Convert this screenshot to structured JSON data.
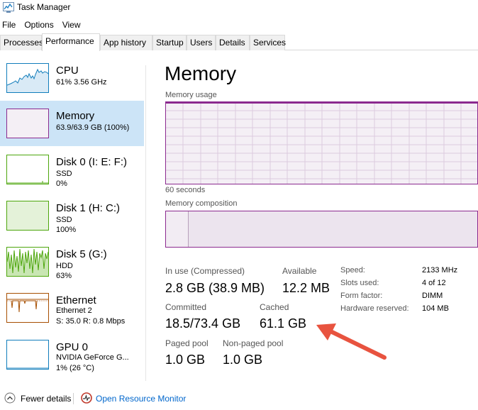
{
  "window": {
    "title": "Task Manager"
  },
  "menu": [
    "File",
    "Options",
    "View"
  ],
  "tabs": [
    "Processes",
    "Performance",
    "App history",
    "Startup",
    "Users",
    "Details",
    "Services"
  ],
  "sidebar": [
    {
      "title": "CPU",
      "line1": "61% 3.56 GHz",
      "line2": ""
    },
    {
      "title": "Memory",
      "line1": "63.9/63.9 GB (100%)",
      "line2": ""
    },
    {
      "title": "Disk 0 (I: E: F:)",
      "line1": "SSD",
      "line2": "0%"
    },
    {
      "title": "Disk 1 (H: C:)",
      "line1": "SSD",
      "line2": "100%"
    },
    {
      "title": "Disk 5 (G:)",
      "line1": "HDD",
      "line2": "63%"
    },
    {
      "title": "Ethernet",
      "line1": "Ethernet 2",
      "line2": "S: 35.0 R: 0.8 Mbps"
    },
    {
      "title": "GPU 0",
      "line1": "NVIDIA GeForce G...",
      "line2": "1% (26 °C)"
    }
  ],
  "main": {
    "title": "Memory",
    "usage_label": "Memory usage",
    "time_label": "60 seconds",
    "composition_label": "Memory composition",
    "in_use_label": "In use (Compressed)",
    "in_use_value": "2.8 GB (38.9 MB)",
    "available_label": "Available",
    "available_value": "12.2 MB",
    "committed_label": "Committed",
    "committed_value": "18.5/73.4 GB",
    "cached_label": "Cached",
    "cached_value": "61.1 GB",
    "paged_label": "Paged pool",
    "paged_value": "1.0 GB",
    "nonpaged_label": "Non-paged pool",
    "nonpaged_value": "1.0 GB",
    "specs": [
      {
        "key": "Speed:",
        "value": "2133 MHz"
      },
      {
        "key": "Slots used:",
        "value": "4 of 12"
      },
      {
        "key": "Form factor:",
        "value": "DIMM"
      },
      {
        "key": "Hardware reserved:",
        "value": "104 MB"
      }
    ]
  },
  "footer": {
    "fewer_details": "Fewer details",
    "resource_monitor": "Open Resource Monitor"
  },
  "colors": {
    "memory_accent": "#8b2a8f",
    "cpu_accent": "#117dbb",
    "disk_accent": "#4da60c",
    "ethernet_accent": "#a74f01",
    "arrow": "#e8533f",
    "selected_bg": "#cce4f7",
    "link": "#0066cc"
  }
}
